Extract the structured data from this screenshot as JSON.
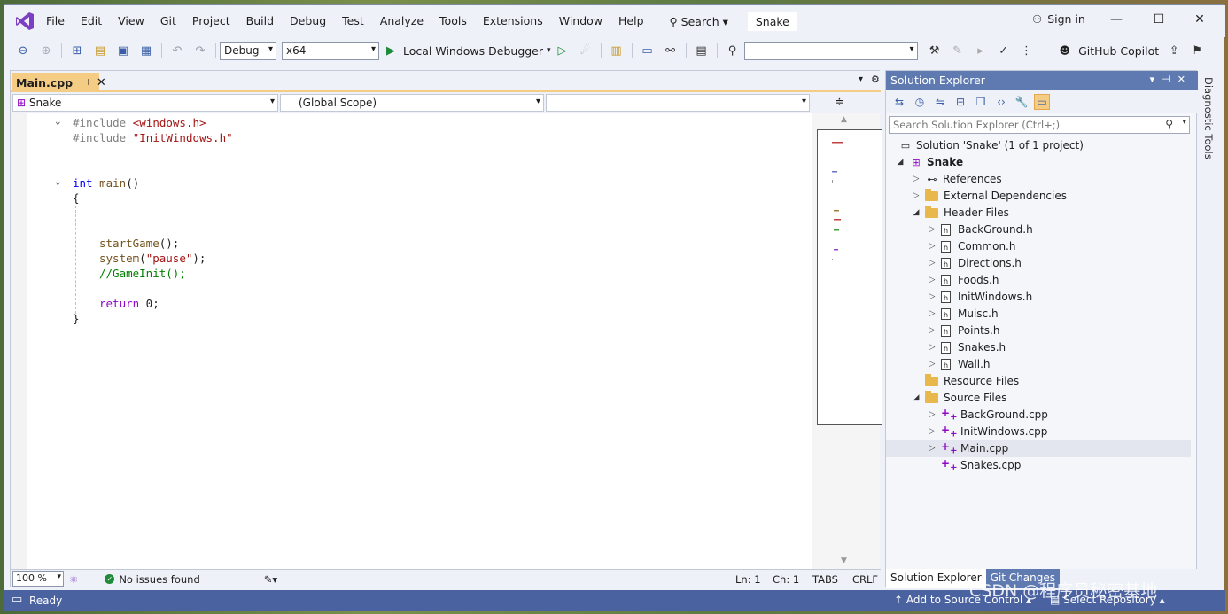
{
  "menu": {
    "items": [
      "File",
      "Edit",
      "View",
      "Git",
      "Project",
      "Build",
      "Debug",
      "Test",
      "Analyze",
      "Tools",
      "Extensions",
      "Window",
      "Help"
    ],
    "search_label": "Search",
    "solution_name": "Snake",
    "sign_in": "Sign in"
  },
  "toolbar": {
    "config": "Debug",
    "platform": "x64",
    "debugger": "Local Windows Debugger",
    "copilot": "GitHub Copilot"
  },
  "editor": {
    "tab_label": "Main.cpp",
    "nav_project": "Snake",
    "nav_scope": "(Global Scope)",
    "nav_member": "",
    "lines": {
      "l1_pp": "#include",
      "l1_file": "<windows.h>",
      "l2_pp": "#include",
      "l2_file": "\"InitWindows.h\"",
      "l5_kw": "int",
      "l5_fn": "main",
      "l5_rest": "()",
      "l6": "{",
      "l9_fn": "startGame",
      "l9_rest": "();",
      "l10_fn": "system",
      "l10_p1": "(",
      "l10_str": "\"pause\"",
      "l10_p2": ");",
      "l11": "//GameInit();",
      "l13_kw": "return",
      "l13_rest": " 0;",
      "l14": "}"
    },
    "status": {
      "zoom": "100 %",
      "issues": "No issues found",
      "line": "Ln: 1",
      "col": "Ch: 1",
      "tabs": "TABS",
      "eol": "CRLF"
    }
  },
  "solution_explorer": {
    "title": "Solution Explorer",
    "search_placeholder": "Search Solution Explorer (Ctrl+;)",
    "solution": "Solution 'Snake' (1 of 1 project)",
    "project": "Snake",
    "references": "References",
    "external": "External Dependencies",
    "header_folder": "Header Files",
    "headers": [
      "BackGround.h",
      "Common.h",
      "Directions.h",
      "Foods.h",
      "InitWindows.h",
      "Muisc.h",
      "Points.h",
      "Snakes.h",
      "Wall.h"
    ],
    "resource_folder": "Resource Files",
    "source_folder": "Source Files",
    "sources": [
      "BackGround.cpp",
      "InitWindows.cpp",
      "Main.cpp",
      "Snakes.cpp"
    ],
    "tab_active": "Solution Explorer",
    "tab_other": "Git Changes"
  },
  "side_panel": "Diagnostic Tools",
  "statusbar": {
    "ready": "Ready",
    "source_control": "Add to Source Control",
    "repository": "Select Repository"
  },
  "watermark": "CSDN @程序员秘密基地"
}
